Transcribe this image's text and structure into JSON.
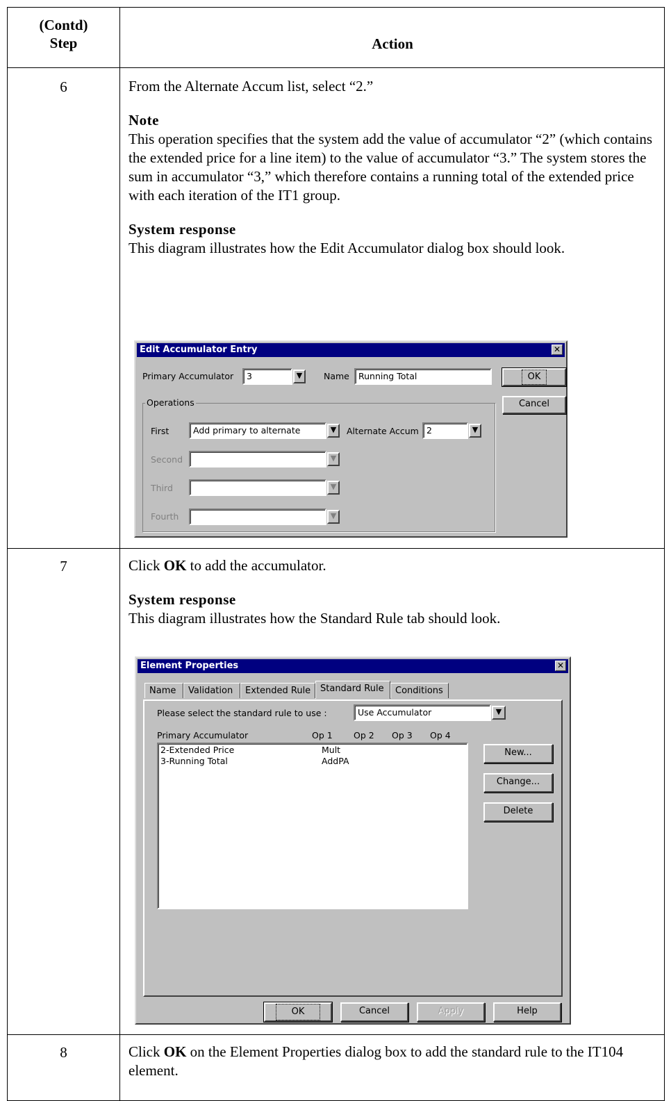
{
  "table": {
    "header": {
      "step_contd": "(Contd)",
      "step": "Step",
      "action": "Action"
    },
    "rows": [
      {
        "step": "6",
        "instruction": "From the Alternate Accum list, select “2.”",
        "note_heading": "Note",
        "note_text": "This operation specifies that the system add the value of accumulator “2” (which contains the extended price for a line item) to the value of accumulator “3.” The system stores the sum in accumulator “3,” which therefore contains a running total of the extended price with each iteration of the IT1 group.",
        "response_heading": "System response",
        "response_text": "This diagram illustrates how the Edit Accumulator dialog box should look."
      },
      {
        "step": "7",
        "instruction_pre": "Click ",
        "instruction_bold": "OK",
        "instruction_post": " to add the accumulator.",
        "response_heading": "System response",
        "response_text": "This diagram illustrates how the Standard Rule tab should look."
      },
      {
        "step": "8",
        "instruction_pre": "Click ",
        "instruction_bold": "OK",
        "instruction_post": " on the Element Properties dialog box to add the standard rule to the IT104 element."
      }
    ]
  },
  "edit_dialog": {
    "title": "Edit Accumulator Entry",
    "primary_label": "Primary Accumulator",
    "primary_value": "3",
    "name_label": "Name",
    "name_value": "Running Total",
    "ok_label": "OK",
    "cancel_label": "Cancel",
    "operations_label": "Operations",
    "first_label": "First",
    "first_value": "Add primary to alternate",
    "alternate_label": "Alternate Accum",
    "alternate_value": "2",
    "second_label": "Second",
    "third_label": "Third",
    "fourth_label": "Fourth"
  },
  "element_dialog": {
    "title": "Element Properties",
    "tabs": [
      "Name",
      "Validation",
      "Extended Rule",
      "Standard Rule",
      "Conditions"
    ],
    "active_tab": "Standard Rule",
    "select_label": "Please select the standard rule to use :",
    "select_value": "Use Accumulator",
    "col_primary": "Primary Accumulator",
    "col_op1": "Op 1",
    "col_op2": "Op 2",
    "col_op3": "Op 3",
    "col_op4": "Op 4",
    "rows": [
      {
        "name": "2-Extended Price",
        "op1": "Mult"
      },
      {
        "name": "3-Running Total",
        "op1": "AddPA"
      }
    ],
    "new_label": "New...",
    "change_label": "Change...",
    "delete_label": "Delete",
    "ok_label": "OK",
    "cancel_label": "Cancel",
    "apply_label": "Apply",
    "help_label": "Help"
  },
  "icons": {
    "close": "close-icon",
    "dropdown": "dropdown-arrow-icon"
  }
}
